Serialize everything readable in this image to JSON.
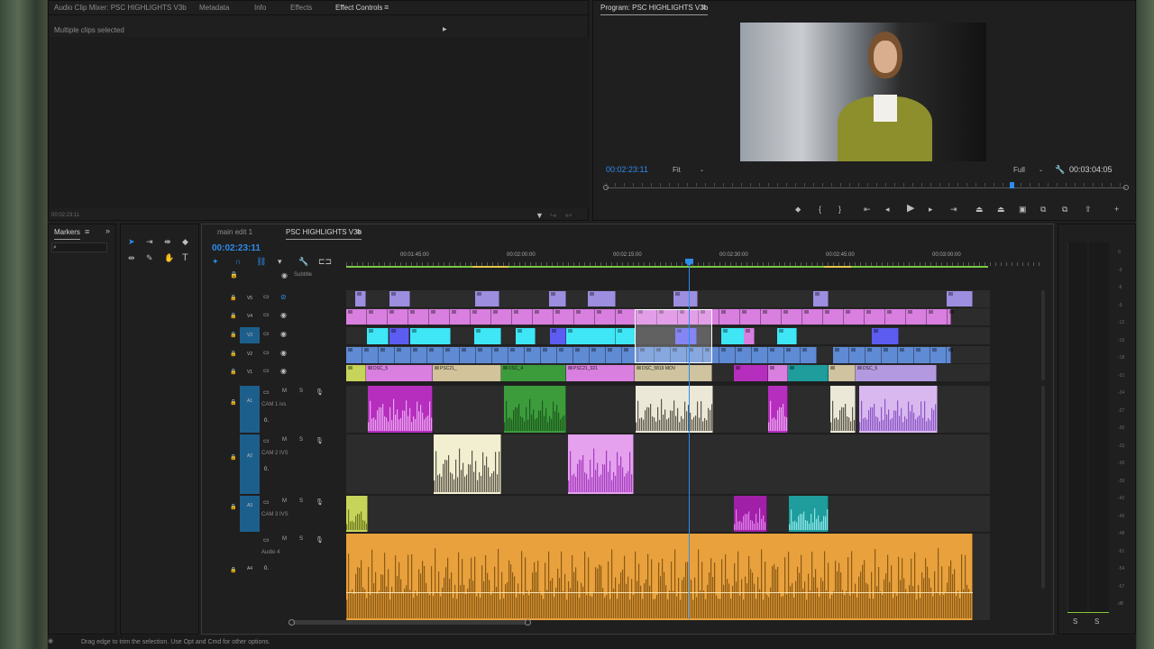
{
  "top_left_panel": {
    "tabs": [
      "Audio Clip Mixer: PSC HIGHLIGHTS V3b",
      "Metadata",
      "Info",
      "Effects",
      "Effect Controls"
    ],
    "active_tab": "Effect Controls",
    "message": "Multiple clips selected",
    "timecode": "00:02:23:11"
  },
  "program_monitor": {
    "title": "Program: PSC HIGHLIGHTS V3b",
    "current_time": "00:02:23:11",
    "fit": "Fit",
    "resolution": "Full",
    "duration": "00:03:04:05",
    "playhead_fraction": 0.78
  },
  "timeline": {
    "left_tabs": [
      "Markers"
    ],
    "tabs": [
      "main edit 1",
      "PSC HIGHLIGHTS V3b"
    ],
    "active_tab": "PSC HIGHLIGHTS V3b",
    "timecode": "00:02:23:11",
    "ruler_labels": [
      "00:01:45:00",
      "00:02:00:00",
      "00:02:15:00",
      "00:02:30:00",
      "00:02:45:00",
      "00:03:00:00"
    ],
    "subtitle_label": "Subtitle",
    "video_tracks": [
      {
        "id": "V5",
        "label": "V5"
      },
      {
        "id": "V4",
        "label": "V4"
      },
      {
        "id": "V3",
        "label": "V3"
      },
      {
        "id": "V2",
        "label": "V2"
      },
      {
        "id": "V1",
        "label": "V1"
      }
    ],
    "audio_tracks": [
      {
        "id": "A1",
        "label": "A1",
        "name": "CAM 1 ivs",
        "volume": "0."
      },
      {
        "id": "A2",
        "label": "A2",
        "name": "CAM 2 IVS",
        "volume": "0."
      },
      {
        "id": "A3",
        "label": "A3",
        "name": "CAM 3 IVS",
        "volume": ""
      },
      {
        "id": "A4",
        "label": "A4",
        "name": "Audio 4",
        "volume": "0."
      }
    ],
    "track_btn_m": "M",
    "track_btn_s": "S",
    "v1_clip_labels": [
      "DSC_5",
      "PSC21_",
      "DSC_4",
      "PSC21_021",
      "DSC_5819 MOV",
      "DSC_5"
    ],
    "db_ticks": [
      "0",
      "-3",
      "-6",
      "-9",
      "-12",
      "-15",
      "-18",
      "-21",
      "-24",
      "-27",
      "-30",
      "-33",
      "-36",
      "-39",
      "-42",
      "-45",
      "-48",
      "-51",
      "-54",
      "-57",
      "dB"
    ],
    "meter_solo": [
      "S",
      "S"
    ]
  },
  "status_bar": {
    "message": "Drag edge to trim the selection. Use Opt and Cmd for other options."
  },
  "colors": {
    "accent_blue": "#2d8ceb",
    "clip_violet": "#9e8ee0",
    "clip_pink": "#d97fe0",
    "clip_cyan": "#3fe6f5",
    "clip_steel": "#5f8ad4",
    "audio_orange": "#e9a13d"
  }
}
